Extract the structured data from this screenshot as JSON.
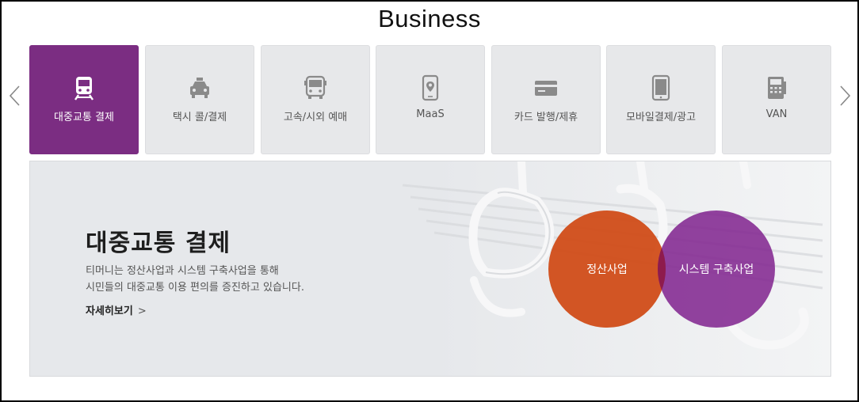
{
  "title": "Business",
  "nav": {
    "prev_icon": "chevron-left-icon",
    "next_icon": "chevron-right-icon"
  },
  "tabs": [
    {
      "label": "대중교통 결제",
      "icon": "train-icon",
      "active": true
    },
    {
      "label": "택시 콜/결제",
      "icon": "taxi-icon",
      "active": false
    },
    {
      "label": "고속/시외 예매",
      "icon": "bus-icon",
      "active": false
    },
    {
      "label": "MaaS",
      "icon": "map-pin-phone-icon",
      "active": false
    },
    {
      "label": "카드 발행/제휴",
      "icon": "card-icon",
      "active": false
    },
    {
      "label": "모바일결제/광고",
      "icon": "tablet-icon",
      "active": false
    },
    {
      "label": "VAN",
      "icon": "terminal-icon",
      "active": false
    }
  ],
  "panel": {
    "heading": "대중교통 결제",
    "desc_line1": "티머니는 정산사업과 시스템 구축사업을 통해",
    "desc_line2": "시민들의 대중교통 이용 편의를 증진하고 있습니다.",
    "more_label": "자세히보기",
    "more_chevron": ">",
    "circles": [
      "정산사업",
      "시스템 구축사업"
    ]
  },
  "colors": {
    "active_tab": "#7b2d82",
    "circle_orange": "#cf4812",
    "circle_purple": "#832891",
    "tab_bg": "#e7e8ea"
  }
}
